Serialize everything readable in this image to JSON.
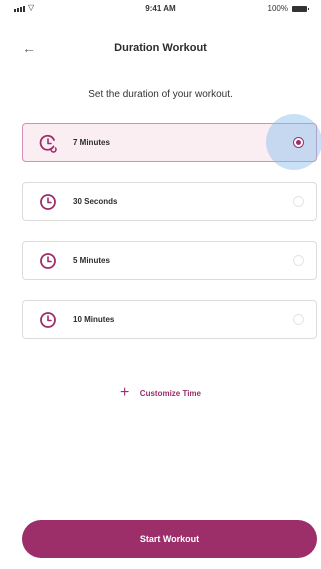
{
  "status_bar": {
    "time": "9:41 AM",
    "battery_text": "100%"
  },
  "nav": {
    "title": "Duration Workout",
    "back_icon": "arrow-left-icon"
  },
  "subtitle": "Set the duration of your workout.",
  "options": [
    {
      "label": "7 Minutes",
      "selected": true
    },
    {
      "label": "30 Seconds",
      "selected": false
    },
    {
      "label": "5 Minutes",
      "selected": false
    },
    {
      "label": "10 Minutes",
      "selected": false
    }
  ],
  "customize_label": "Customize Time",
  "start_label": "Start Workout",
  "colors": {
    "accent": "#9c2f6a",
    "selected_bg": "#fbeef3",
    "selected_border": "#d68fb0",
    "highlight": "#86bceb"
  }
}
